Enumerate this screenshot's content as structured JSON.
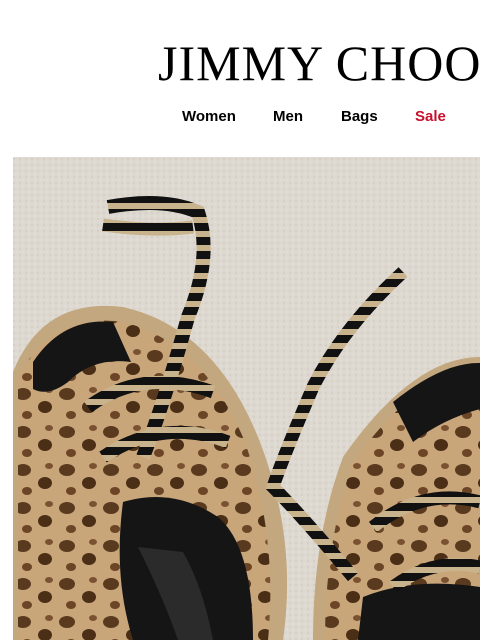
{
  "brand": {
    "logo_text": "JIMMY CHOO"
  },
  "nav": {
    "items": [
      {
        "label": "Women"
      },
      {
        "label": "Men"
      },
      {
        "label": "Bags"
      },
      {
        "label": "Sale",
        "color": "#c8102e"
      }
    ]
  },
  "hero": {
    "colors": {
      "carpet": "#ddd8d0",
      "suede": "#151515",
      "leopard": "#c9a57a",
      "sole": "#c3a77f"
    }
  }
}
